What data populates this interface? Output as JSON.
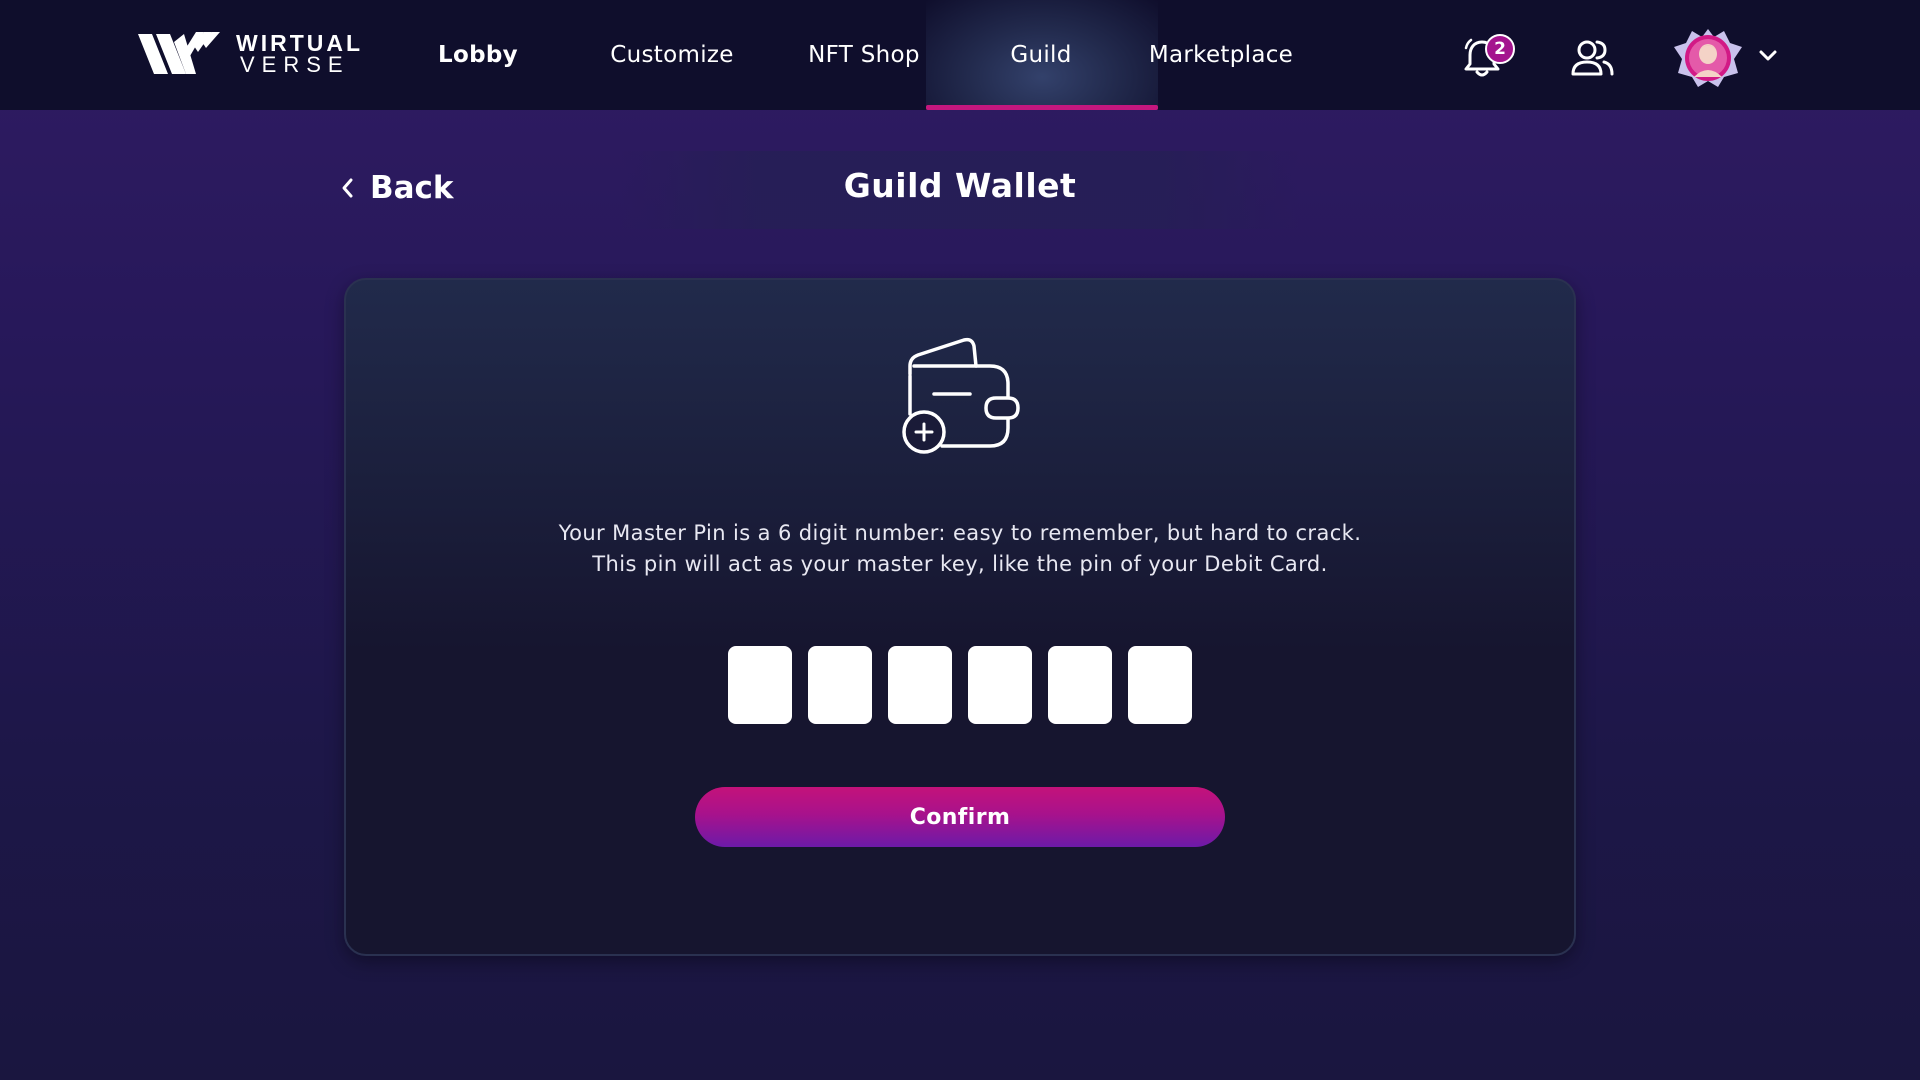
{
  "brand": {
    "line1": "WIRTUAL",
    "line2": "VERSE"
  },
  "nav": {
    "items": [
      {
        "label": "Lobby"
      },
      {
        "label": "Customize"
      },
      {
        "label": "NFT Shop"
      },
      {
        "label": "Guild",
        "active": true
      },
      {
        "label": "Marketplace"
      }
    ],
    "notifications_count": "2",
    "icons": [
      "bell-icon",
      "friends-icon",
      "avatar",
      "chevron-down-icon"
    ]
  },
  "header": {
    "back_label": "Back",
    "title": "Guild Wallet"
  },
  "card": {
    "description_line1": "Your Master Pin is a 6 digit number: easy to remember, but hard to crack.",
    "description_line2": "This pin will act as your master key, like the pin of your Debit Card.",
    "pin_digits": [
      "",
      "",
      "",
      "",
      "",
      ""
    ],
    "confirm_label": "Confirm",
    "icon": "wallet-add-icon"
  },
  "colors": {
    "nav_bg": "#0f0e2c",
    "accent": "#c4177e",
    "badge": "#a4148e",
    "button_gradient_top": "#c4127a",
    "button_gradient_bottom": "#6c1aa8"
  }
}
